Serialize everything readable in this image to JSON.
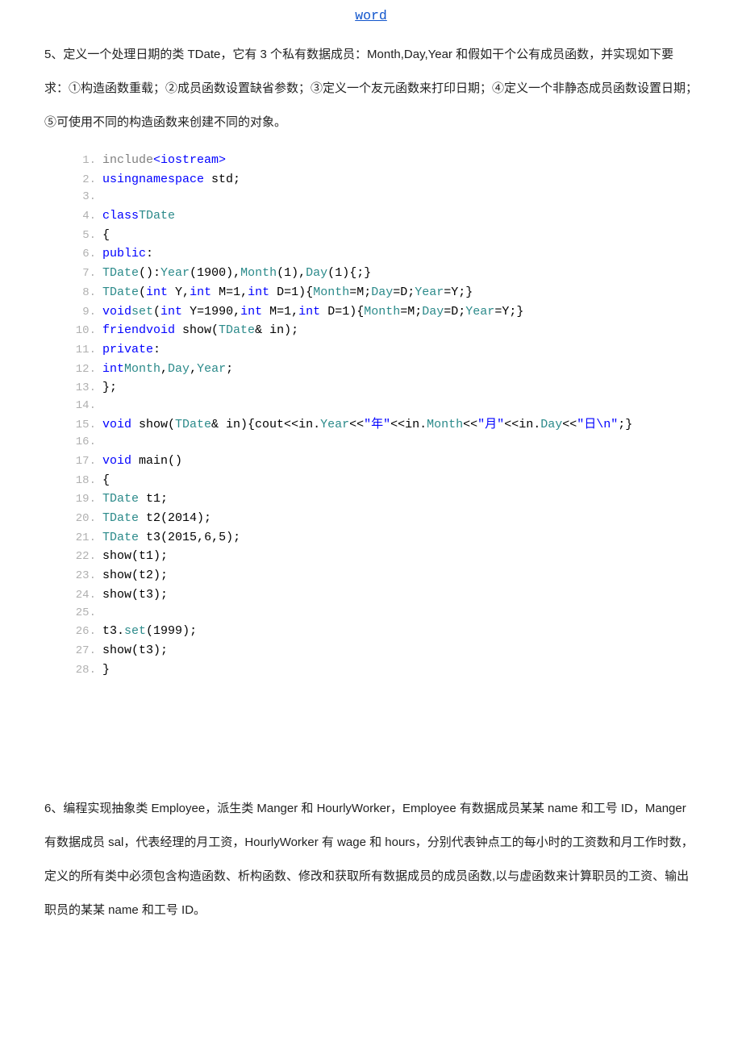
{
  "header": {
    "link": "word"
  },
  "question5": {
    "text": "5、定义一个处理日期的类 TDate，它有 3 个私有数据成员：Month,Day,Year 和假如干个公有成员函数，并实现如下要求：①构造函数重载；②成员函数设置缺省参数；③定义一个友元函数来打印日期；④定义一个非静态成员函数设置日期；⑤可使用不同的构造函数来创建不同的对象。"
  },
  "code": {
    "lines": [
      {
        "n": "1.",
        "seg": [
          {
            "c": "gray",
            "t": "include"
          },
          {
            "c": "kw",
            "t": "<iostream>"
          }
        ]
      },
      {
        "n": "2.",
        "seg": [
          {
            "c": "kw",
            "t": "using"
          },
          {
            "c": "kw",
            "t": "namespace"
          },
          {
            "c": "plain",
            "t": " std;"
          }
        ]
      },
      {
        "n": "3.",
        "seg": []
      },
      {
        "n": "4.",
        "seg": [
          {
            "c": "kw",
            "t": "class"
          },
          {
            "c": "teal",
            "t": "TDate"
          }
        ]
      },
      {
        "n": "5.",
        "seg": [
          {
            "c": "plain",
            "t": "{"
          }
        ]
      },
      {
        "n": "6.",
        "seg": [
          {
            "c": "kw",
            "t": "public"
          },
          {
            "c": "plain",
            "t": ":"
          }
        ]
      },
      {
        "n": "7.",
        "seg": [
          {
            "c": "teal",
            "t": "TDate"
          },
          {
            "c": "plain",
            "t": "():"
          },
          {
            "c": "teal",
            "t": "Year"
          },
          {
            "c": "plain",
            "t": "("
          },
          {
            "c": "plain",
            "t": "1900"
          },
          {
            "c": "plain",
            "t": "),"
          },
          {
            "c": "teal",
            "t": "Month"
          },
          {
            "c": "plain",
            "t": "("
          },
          {
            "c": "plain",
            "t": "1"
          },
          {
            "c": "plain",
            "t": "),"
          },
          {
            "c": "teal",
            "t": "Day"
          },
          {
            "c": "plain",
            "t": "("
          },
          {
            "c": "plain",
            "t": "1"
          },
          {
            "c": "plain",
            "t": "){;}"
          }
        ]
      },
      {
        "n": "8.",
        "seg": [
          {
            "c": "teal",
            "t": "TDate"
          },
          {
            "c": "plain",
            "t": "("
          },
          {
            "c": "kw",
            "t": "int"
          },
          {
            "c": "plain",
            "t": " Y,"
          },
          {
            "c": "kw",
            "t": "int"
          },
          {
            "c": "plain",
            "t": " M="
          },
          {
            "c": "plain",
            "t": "1"
          },
          {
            "c": "plain",
            "t": ","
          },
          {
            "c": "kw",
            "t": "int"
          },
          {
            "c": "plain",
            "t": " D="
          },
          {
            "c": "plain",
            "t": "1"
          },
          {
            "c": "plain",
            "t": "){"
          },
          {
            "c": "teal",
            "t": "Month"
          },
          {
            "c": "plain",
            "t": "=M;"
          },
          {
            "c": "teal",
            "t": "Day"
          },
          {
            "c": "plain",
            "t": "=D;"
          },
          {
            "c": "teal",
            "t": "Year"
          },
          {
            "c": "plain",
            "t": "=Y;}"
          }
        ]
      },
      {
        "n": "9.",
        "seg": [
          {
            "c": "kw",
            "t": "void"
          },
          {
            "c": "teal",
            "t": "set"
          },
          {
            "c": "plain",
            "t": "("
          },
          {
            "c": "kw",
            "t": "int"
          },
          {
            "c": "plain",
            "t": " Y="
          },
          {
            "c": "plain",
            "t": "1990"
          },
          {
            "c": "plain",
            "t": ","
          },
          {
            "c": "kw",
            "t": "int"
          },
          {
            "c": "plain",
            "t": " M="
          },
          {
            "c": "plain",
            "t": "1"
          },
          {
            "c": "plain",
            "t": ","
          },
          {
            "c": "kw",
            "t": "int"
          },
          {
            "c": "plain",
            "t": " D="
          },
          {
            "c": "plain",
            "t": "1"
          },
          {
            "c": "plain",
            "t": "){"
          },
          {
            "c": "teal",
            "t": "Month"
          },
          {
            "c": "plain",
            "t": "=M;"
          },
          {
            "c": "teal",
            "t": "Day"
          },
          {
            "c": "plain",
            "t": "=D;"
          },
          {
            "c": "teal",
            "t": "Year"
          },
          {
            "c": "plain",
            "t": "=Y;}"
          }
        ]
      },
      {
        "n": "10.",
        "seg": [
          {
            "c": "kw",
            "t": "friend"
          },
          {
            "c": "kw",
            "t": "void"
          },
          {
            "c": "plain",
            "t": " show("
          },
          {
            "c": "teal",
            "t": "TDate"
          },
          {
            "c": "plain",
            "t": "& in);"
          }
        ]
      },
      {
        "n": "11.",
        "seg": [
          {
            "c": "kw",
            "t": "private"
          },
          {
            "c": "plain",
            "t": ":"
          }
        ]
      },
      {
        "n": "12.",
        "seg": [
          {
            "c": "kw",
            "t": "int"
          },
          {
            "c": "teal",
            "t": "Month"
          },
          {
            "c": "plain",
            "t": ","
          },
          {
            "c": "teal",
            "t": "Day"
          },
          {
            "c": "plain",
            "t": ","
          },
          {
            "c": "teal",
            "t": "Year"
          },
          {
            "c": "plain",
            "t": ";"
          }
        ]
      },
      {
        "n": "13.",
        "seg": [
          {
            "c": "plain",
            "t": "};"
          }
        ]
      },
      {
        "n": "14.",
        "seg": []
      },
      {
        "n": "15.",
        "seg": [
          {
            "c": "kw",
            "t": "void"
          },
          {
            "c": "plain",
            "t": " show("
          },
          {
            "c": "teal",
            "t": "TDate"
          },
          {
            "c": "plain",
            "t": "& in){cout<<in."
          },
          {
            "c": "teal",
            "t": "Year"
          },
          {
            "c": "plain",
            "t": "<<"
          },
          {
            "c": "str",
            "t": "\"年\""
          },
          {
            "c": "plain",
            "t": "<<in."
          },
          {
            "c": "teal",
            "t": "Month"
          },
          {
            "c": "plain",
            "t": "<<"
          },
          {
            "c": "str",
            "t": "\"月\""
          },
          {
            "c": "plain",
            "t": "<<in."
          },
          {
            "c": "teal",
            "t": "Day"
          },
          {
            "c": "plain",
            "t": "<<"
          },
          {
            "c": "str",
            "t": "\"日\\n\""
          },
          {
            "c": "plain",
            "t": ";}"
          }
        ]
      },
      {
        "n": "16.",
        "seg": []
      },
      {
        "n": "17.",
        "seg": [
          {
            "c": "kw",
            "t": "void"
          },
          {
            "c": "plain",
            "t": " main()"
          }
        ]
      },
      {
        "n": "18.",
        "seg": [
          {
            "c": "plain",
            "t": "{"
          }
        ]
      },
      {
        "n": "19.",
        "seg": [
          {
            "c": "teal",
            "t": "TDate"
          },
          {
            "c": "plain",
            "t": " t1;"
          }
        ]
      },
      {
        "n": "20.",
        "seg": [
          {
            "c": "teal",
            "t": "TDate"
          },
          {
            "c": "plain",
            "t": " t2("
          },
          {
            "c": "plain",
            "t": "2014"
          },
          {
            "c": "plain",
            "t": ");"
          }
        ]
      },
      {
        "n": "21.",
        "seg": [
          {
            "c": "teal",
            "t": "TDate"
          },
          {
            "c": "plain",
            "t": " t3("
          },
          {
            "c": "plain",
            "t": "2015"
          },
          {
            "c": "plain",
            "t": ","
          },
          {
            "c": "plain",
            "t": "6"
          },
          {
            "c": "plain",
            "t": ","
          },
          {
            "c": "plain",
            "t": "5"
          },
          {
            "c": "plain",
            "t": ");"
          }
        ]
      },
      {
        "n": "22.",
        "seg": [
          {
            "c": "plain",
            "t": "show(t1);"
          }
        ]
      },
      {
        "n": "23.",
        "seg": [
          {
            "c": "plain",
            "t": "show(t2);"
          }
        ]
      },
      {
        "n": "24.",
        "seg": [
          {
            "c": "plain",
            "t": "show(t3);"
          }
        ]
      },
      {
        "n": "25.",
        "seg": []
      },
      {
        "n": "26.",
        "seg": [
          {
            "c": "plain",
            "t": "t3."
          },
          {
            "c": "teal",
            "t": "set"
          },
          {
            "c": "plain",
            "t": "("
          },
          {
            "c": "plain",
            "t": "1999"
          },
          {
            "c": "plain",
            "t": ");"
          }
        ]
      },
      {
        "n": "27.",
        "seg": [
          {
            "c": "plain",
            "t": "show(t3);"
          }
        ]
      },
      {
        "n": "28.",
        "seg": [
          {
            "c": "plain",
            "t": "}"
          }
        ]
      }
    ]
  },
  "question6": {
    "text": "6、编程实现抽象类 Employee，派生类 Manger 和 HourlyWorker，Employee 有数据成员某某 name 和工号 ID，Manger 有数据成员 sal，代表经理的月工资，HourlyWorker 有 wage 和 hours，分别代表钟点工的每小时的工资数和月工作时数，定义的所有类中必须包含构造函数、析构函数、修改和获取所有数据成员的成员函数,以与虚函数来计算职员的工资、输出职员的某某 name 和工号 ID。"
  }
}
